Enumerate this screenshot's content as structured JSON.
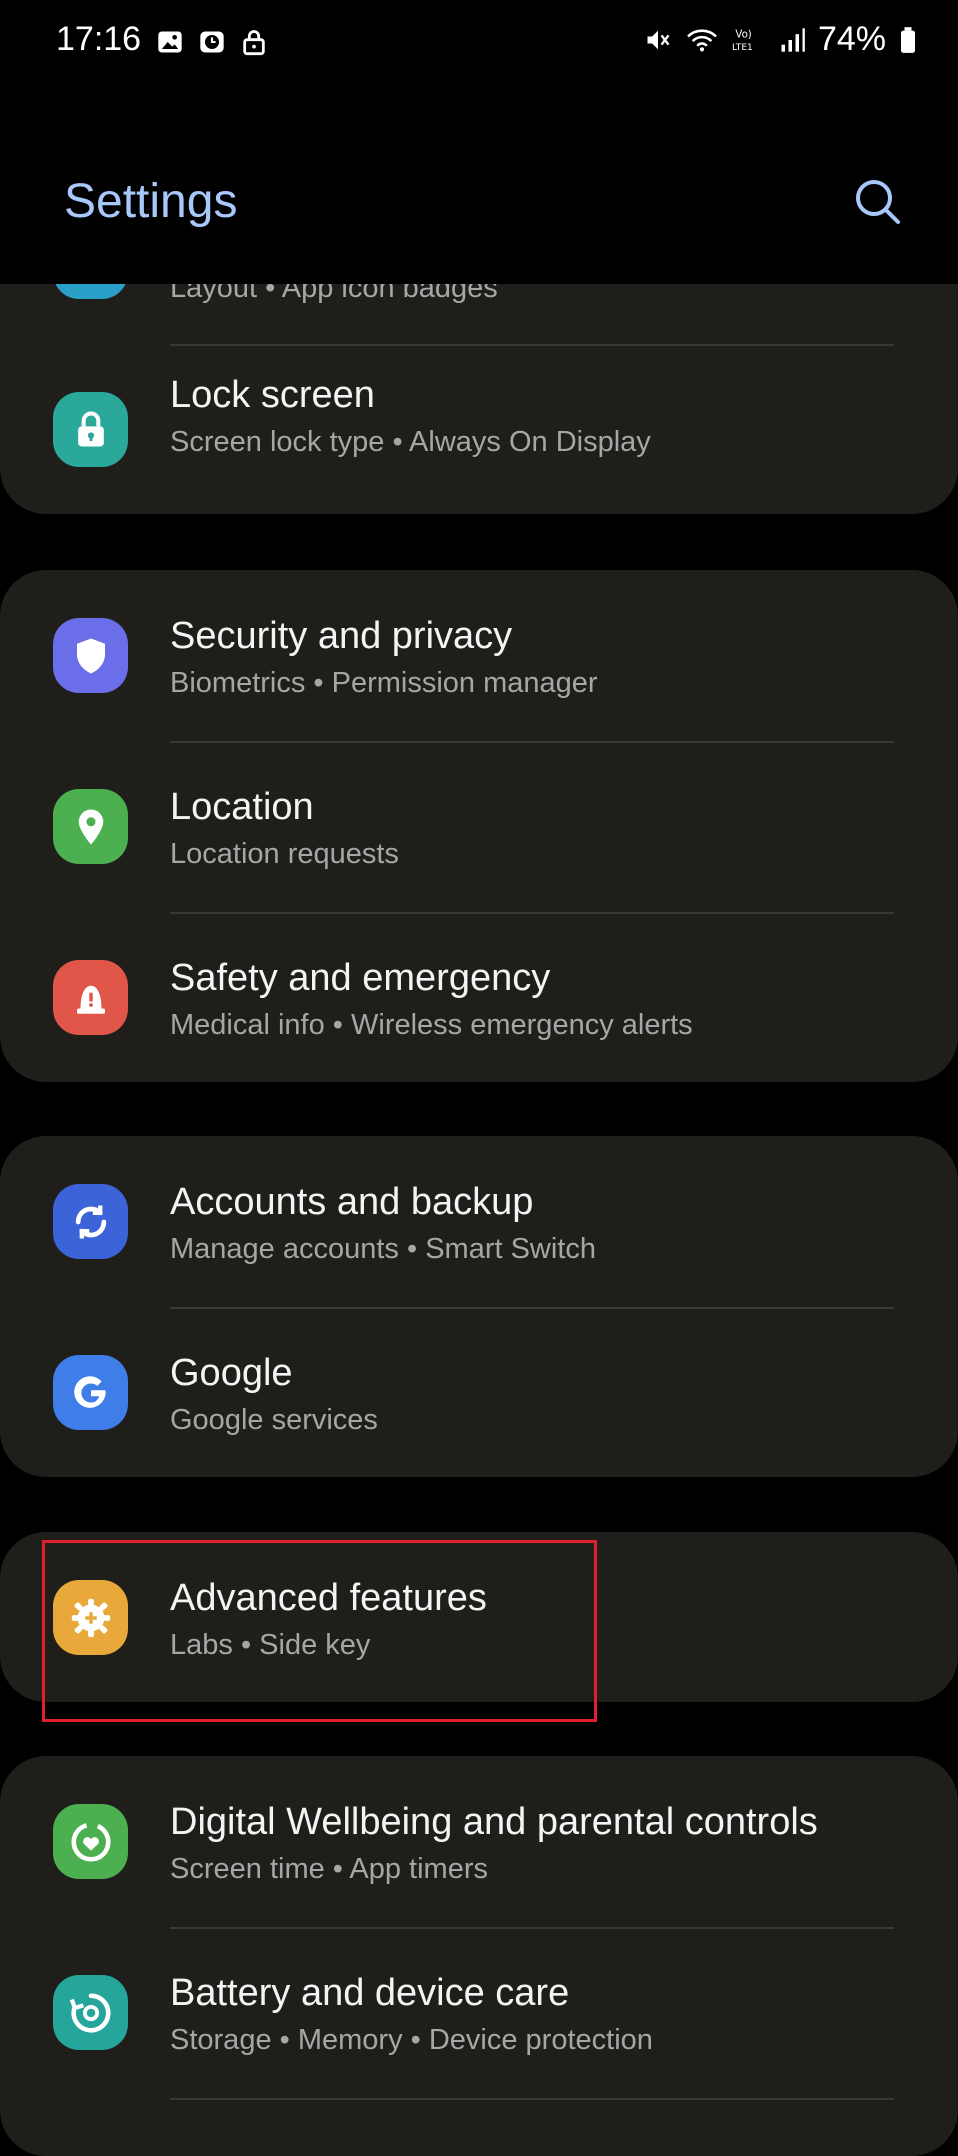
{
  "status_bar": {
    "time": "17:16",
    "battery_pct": "74%",
    "left_icons": [
      "gallery-icon",
      "clock-icon",
      "lock-icon"
    ],
    "right_icons": [
      "mute-icon",
      "wifi-icon",
      "volte-icon",
      "signal-icon",
      "battery-icon"
    ]
  },
  "header": {
    "title": "Settings",
    "search_icon": "search-icon"
  },
  "partial_row": {
    "sub": "Layout  •  App icon badges"
  },
  "groups": [
    {
      "items": [
        {
          "title": "Lock screen",
          "sub": "Screen lock type  •  Always On Display",
          "icon": "lock-icon",
          "color": "#2aa89a"
        }
      ]
    },
    {
      "items": [
        {
          "title": "Security and privacy",
          "sub": "Biometrics  •  Permission manager",
          "icon": "shield-icon",
          "color": "#6a6ee8"
        },
        {
          "title": "Location",
          "sub": "Location requests",
          "icon": "location-pin-icon",
          "color": "#4caf50"
        },
        {
          "title": "Safety and emergency",
          "sub": "Medical info  •  Wireless emergency alerts",
          "icon": "alert-icon",
          "color": "#e0574a"
        }
      ]
    },
    {
      "items": [
        {
          "title": "Accounts and backup",
          "sub": "Manage accounts  •  Smart Switch",
          "icon": "sync-icon",
          "color": "#3d63d8"
        },
        {
          "title": "Google",
          "sub": "Google services",
          "icon": "google-icon",
          "color": "#3f7de8"
        }
      ]
    },
    {
      "items": [
        {
          "title": "Advanced features",
          "sub": "Labs  •  Side key",
          "icon": "gear-plus-icon",
          "color": "#e8a93a"
        }
      ]
    },
    {
      "items": [
        {
          "title": "Digital Wellbeing and parental controls",
          "sub": "Screen time  •  App timers",
          "icon": "heart-circle-icon",
          "color": "#4caf50"
        },
        {
          "title": "Battery and device care",
          "sub": "Storage  •  Memory  •  Device protection",
          "icon": "refresh-circle-icon",
          "color": "#26a69a"
        }
      ]
    }
  ],
  "accent": "#a8c7fa",
  "highlight_color": "#e0202a"
}
